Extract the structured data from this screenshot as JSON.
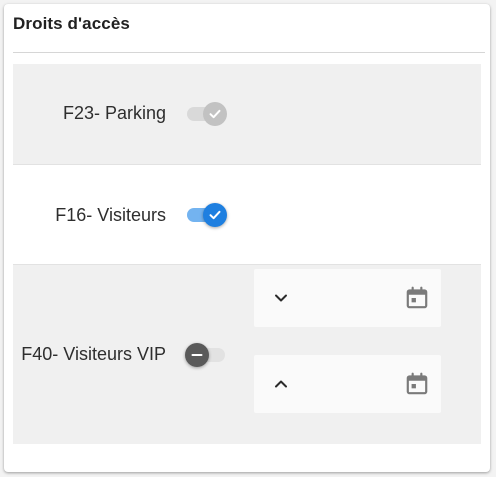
{
  "card": {
    "title": "Droits d'accès"
  },
  "access_rights": [
    {
      "label": "F23- Parking",
      "state": "disabled-checked"
    },
    {
      "label": "F16- Visiteurs",
      "state": "checked"
    },
    {
      "label": "F40- Visiteurs VIP",
      "state": "indeterminate"
    }
  ],
  "date_fields": [
    {
      "icon": "chevron-down-icon",
      "trailing_icon": "calendar-icon",
      "value": ""
    },
    {
      "icon": "chevron-up-icon",
      "trailing_icon": "calendar-icon",
      "value": ""
    }
  ],
  "colors": {
    "accent": "#1e7fe0",
    "accent_track": "#73b3f0",
    "row_grey": "#f0f0f0",
    "disabled_knob": "#c2c2c2",
    "indeterminate_knob": "#5a5a5a"
  }
}
